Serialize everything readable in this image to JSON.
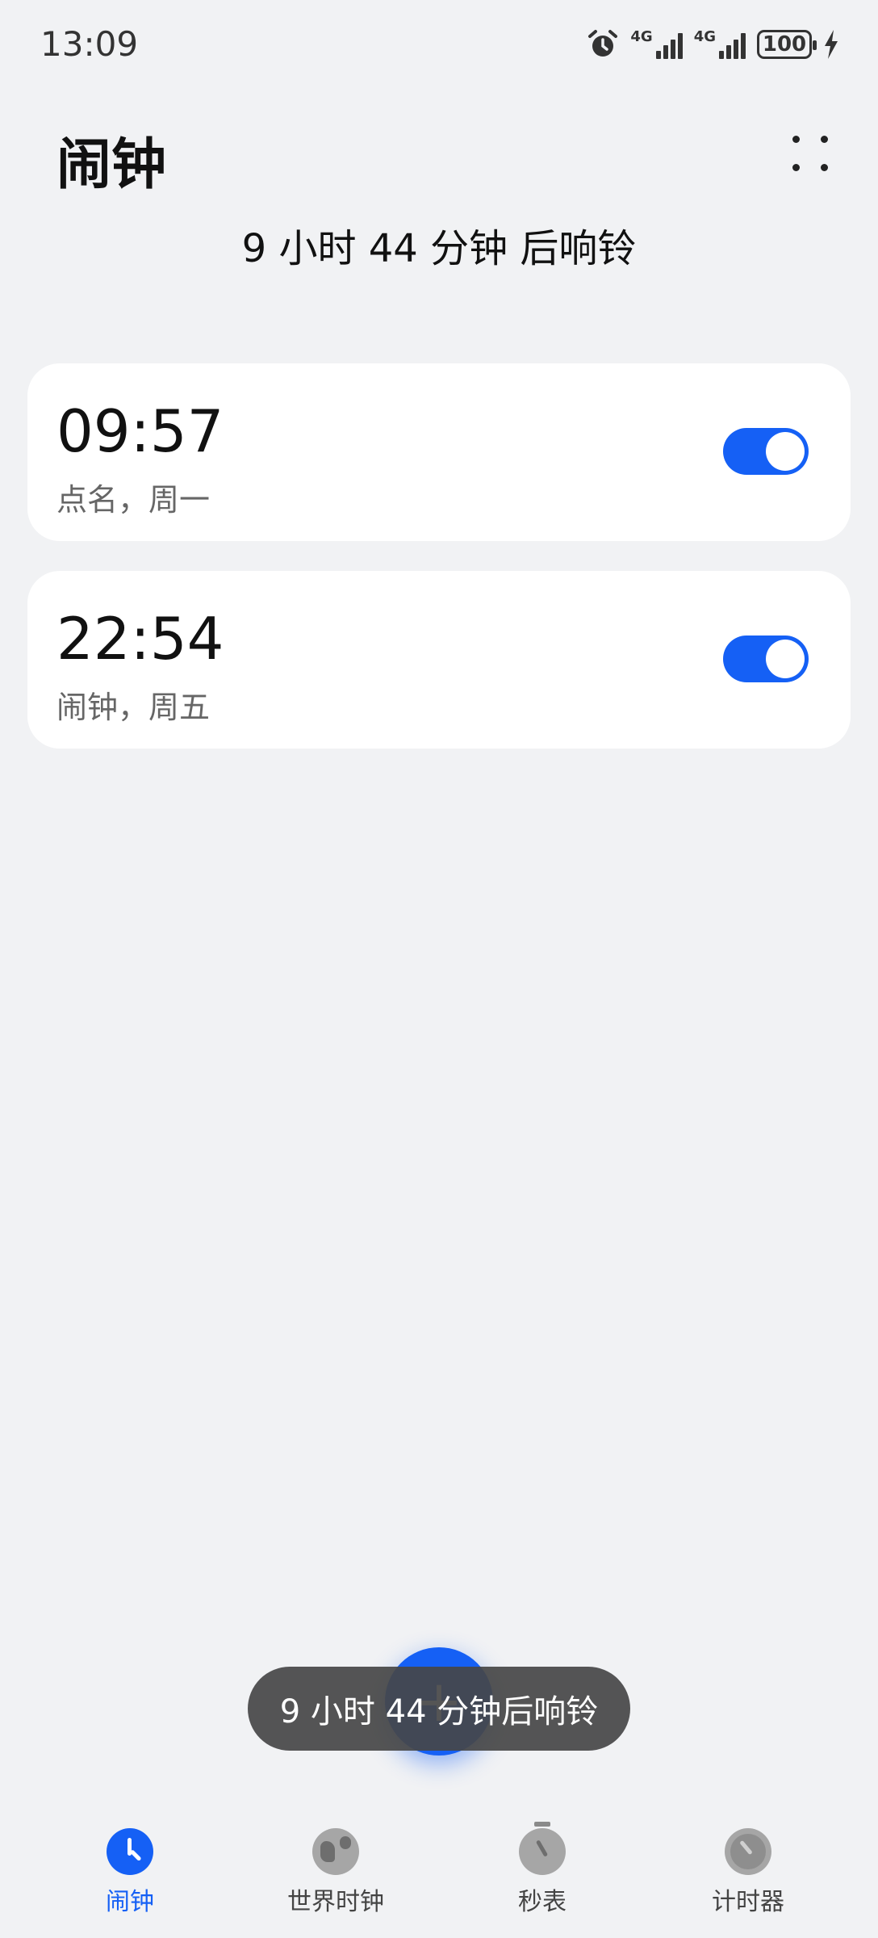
{
  "status_bar": {
    "time": "13:09",
    "network_1": "4G",
    "network_2": "4G",
    "battery_level": "100",
    "icons": [
      "alarm-icon",
      "signal-icon",
      "signal-icon",
      "battery-icon",
      "charging-icon"
    ]
  },
  "header": {
    "title": "闹钟",
    "next_ring": "9 小时 44 分钟 后响铃"
  },
  "alarms": [
    {
      "time": "09:57",
      "description": "点名，周一",
      "enabled": true
    },
    {
      "time": "22:54",
      "description": "闹钟，周五",
      "enabled": true
    }
  ],
  "fab": {
    "label": "+"
  },
  "toast": {
    "text": "9 小时 44 分钟后响铃"
  },
  "tabs": [
    {
      "label": "闹钟",
      "icon": "alarm-clock-icon",
      "active": true
    },
    {
      "label": "世界时钟",
      "icon": "globe-icon",
      "active": false
    },
    {
      "label": "秒表",
      "icon": "stopwatch-icon",
      "active": false
    },
    {
      "label": "计时器",
      "icon": "timer-icon",
      "active": false
    }
  ],
  "colors": {
    "accent": "#1560F5",
    "background": "#F1F2F4",
    "card": "#FFFFFF",
    "toast": "#464646"
  }
}
